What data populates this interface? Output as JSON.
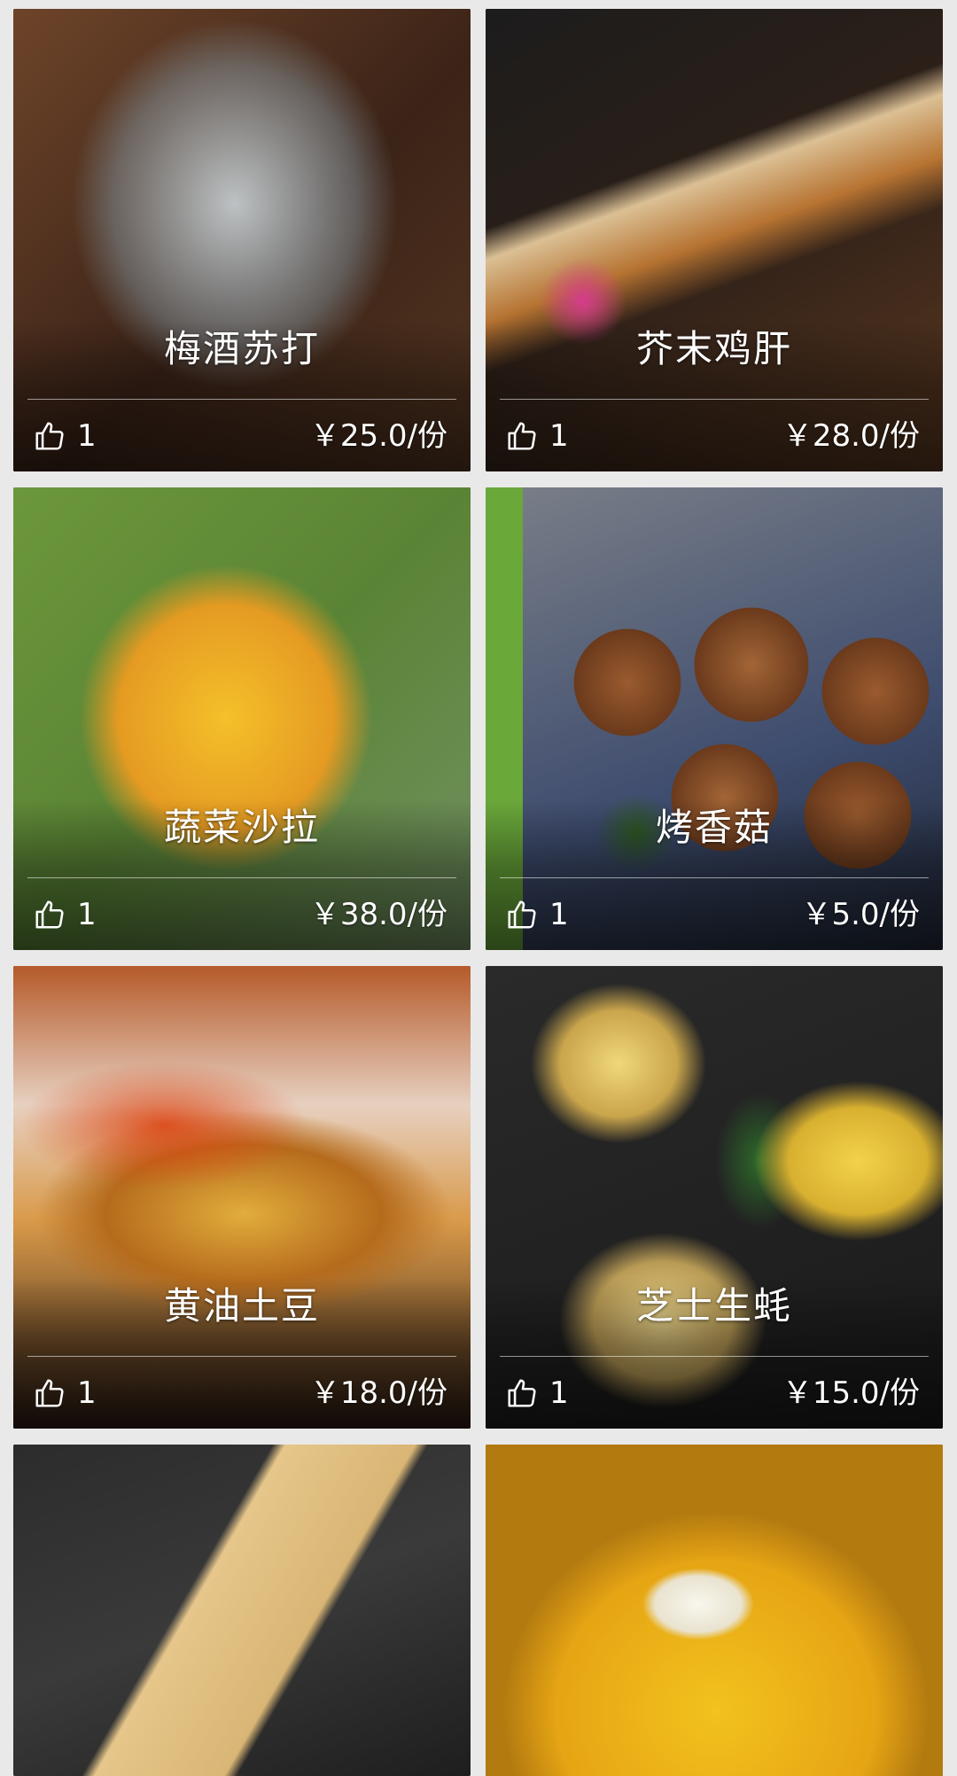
{
  "grid": {
    "items": [
      {
        "name": "梅酒苏打",
        "likes": "1",
        "price": "￥25.0/份"
      },
      {
        "name": "芥末鸡肝",
        "likes": "1",
        "price": "￥28.0/份"
      },
      {
        "name": "蔬菜沙拉",
        "likes": "1",
        "price": "￥38.0/份"
      },
      {
        "name": "烤香菇",
        "likes": "1",
        "price": "￥5.0/份"
      },
      {
        "name": "黄油土豆",
        "likes": "1",
        "price": "￥18.0/份"
      },
      {
        "name": "芝士生蚝",
        "likes": "1",
        "price": "￥15.0/份"
      }
    ]
  },
  "icons": {
    "like": "thumbs-up-icon"
  }
}
